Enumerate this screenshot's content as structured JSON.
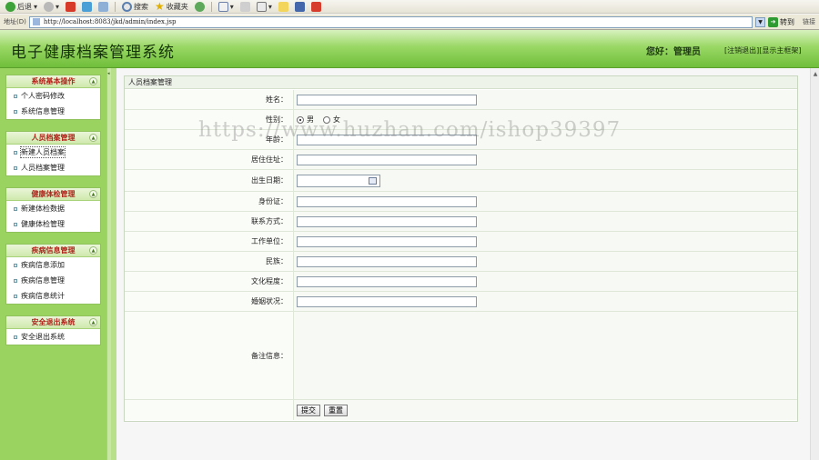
{
  "browser": {
    "toolbar": {
      "back_label": "后退",
      "search_label": "搜索",
      "favorites_label": "收藏夹"
    },
    "address": {
      "label": "地址(D)",
      "url": "http://localhost:8083/jkd/admin/index.jsp",
      "go_label": "转到",
      "links_label": "链接"
    }
  },
  "header": {
    "title": "电子健康档案管理系统",
    "welcome": "您好：管理员",
    "links": [
      "[注销退出]",
      "[显示主框架]"
    ]
  },
  "sidebar": {
    "groups": [
      {
        "title": "系统基本操作",
        "items": [
          "个人密码修改",
          "系统信息管理"
        ]
      },
      {
        "title": "人员档案管理",
        "items": [
          "新建人员档案",
          "人员档案管理"
        ]
      },
      {
        "title": "健康体检管理",
        "items": [
          "新建体检数据",
          "健康体检管理"
        ]
      },
      {
        "title": "疾病信息管理",
        "items": [
          "疾病信息添加",
          "疾病信息管理",
          "疾病信息统计"
        ]
      },
      {
        "title": "安全退出系统",
        "items": [
          "安全退出系统"
        ]
      }
    ]
  },
  "form": {
    "panel_title": "人员档案管理",
    "fields": {
      "name": "姓名：",
      "gender": "性别：",
      "age": "年龄：",
      "address": "居住住址：",
      "birthdate": "出生日期：",
      "id_card": "身份证：",
      "contact": "联系方式：",
      "work_unit": "工作单位：",
      "ethnicity": "民族：",
      "education": "文化程度：",
      "marital": "婚姻状况：",
      "remarks": "备注信息："
    },
    "gender_options": [
      "男",
      "女"
    ],
    "gender_selected": "男",
    "submit_label": "提交",
    "reset_label": "重置"
  },
  "watermark": "https://www.huzhan.com/ishop39397"
}
